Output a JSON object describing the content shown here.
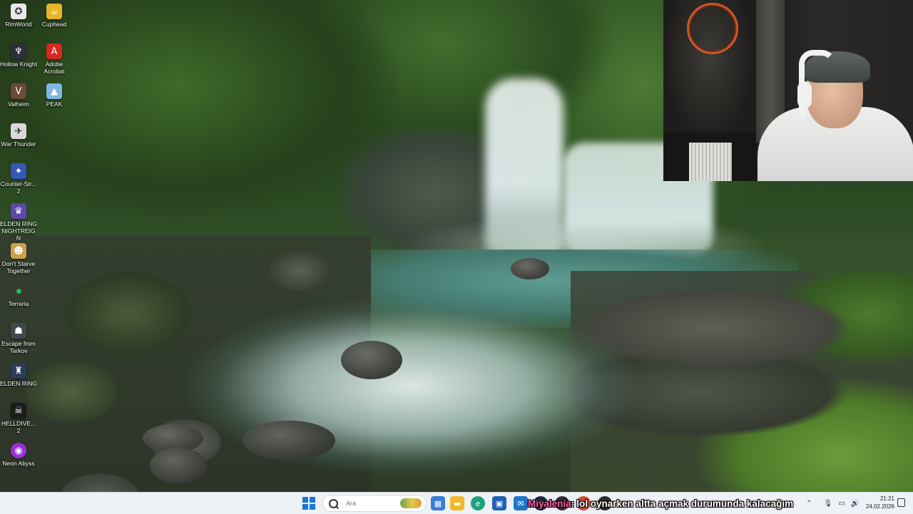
{
  "desktop": {
    "icons": [
      {
        "label": "RimWorld",
        "icon": "rimworld-icon",
        "color": "#e9e9e9"
      },
      {
        "label": "Cuphead",
        "icon": "cuphead-icon",
        "color": "#e6b628"
      },
      {
        "label": "Hollow Knight",
        "icon": "hollow-knight-icon",
        "color": "#2d2f3a"
      },
      {
        "label": "Adobe Acrobat",
        "icon": "adobe-acrobat-icon",
        "color": "#d7281f"
      },
      {
        "label": "Valheim",
        "icon": "valheim-icon",
        "color": "#6b4a38"
      },
      {
        "label": "PEAK",
        "icon": "peak-icon",
        "color": "#7fb6e6"
      },
      {
        "label": "War Thunder",
        "icon": "war-thunder-icon",
        "color": "#d9d9d9"
      },
      {
        "label": "Counter-Str... 2",
        "icon": "counter-strike-icon",
        "color": "#3457b8"
      },
      {
        "label": "ELDEN RING NIGHTREIGN",
        "icon": "elden-ring-nightreign-icon",
        "color": "#5b4aa8"
      },
      {
        "label": "Don't Starve Together",
        "icon": "dont-starve-together-icon",
        "color": "#c9a24b"
      },
      {
        "label": "Terraria",
        "icon": "terraria-icon",
        "color": "#2fb552"
      },
      {
        "label": "Escape from Tarkov",
        "icon": "escape-from-tarkov-icon",
        "color": "#3d4a4c"
      },
      {
        "label": "ELDEN RING",
        "icon": "elden-ring-icon",
        "color": "#2c3c5a"
      },
      {
        "label": "HELLDIVE... 2",
        "icon": "helldivers-icon",
        "color": "#1c1c1c"
      },
      {
        "label": "Neon Abyss",
        "icon": "neon-abyss-icon",
        "color": "#9b2fd6"
      }
    ]
  },
  "taskbar": {
    "search_placeholder": "Ara",
    "apps": [
      {
        "icon": "store-icon",
        "color": "#3a7bd5"
      },
      {
        "icon": "file-explorer-icon",
        "color": "#f2b925"
      },
      {
        "icon": "edge-icon",
        "color": "#1aa37a"
      },
      {
        "icon": "app-icon",
        "color": "#1f5fb8"
      },
      {
        "icon": "outlook-icon",
        "color": "#1f76c9"
      },
      {
        "icon": "steam-icon",
        "color": "#1b2838"
      },
      {
        "icon": "obs-icon",
        "color": "#302e31"
      },
      {
        "icon": "chrome-icon",
        "color": "#d64a3a"
      },
      {
        "icon": "record-icon",
        "color": "#2b2b2b"
      }
    ],
    "tray": {
      "chevron": "chevron-up-icon",
      "mic": "microphone-icon",
      "network": "network-icon",
      "volume": "volume-icon"
    },
    "time": "21:21",
    "date": "24.02.2026"
  },
  "chat": {
    "user": "Miyalenia",
    "separator": ":",
    "message": "lol oynarken altta açmak durumunda kalacağım"
  }
}
